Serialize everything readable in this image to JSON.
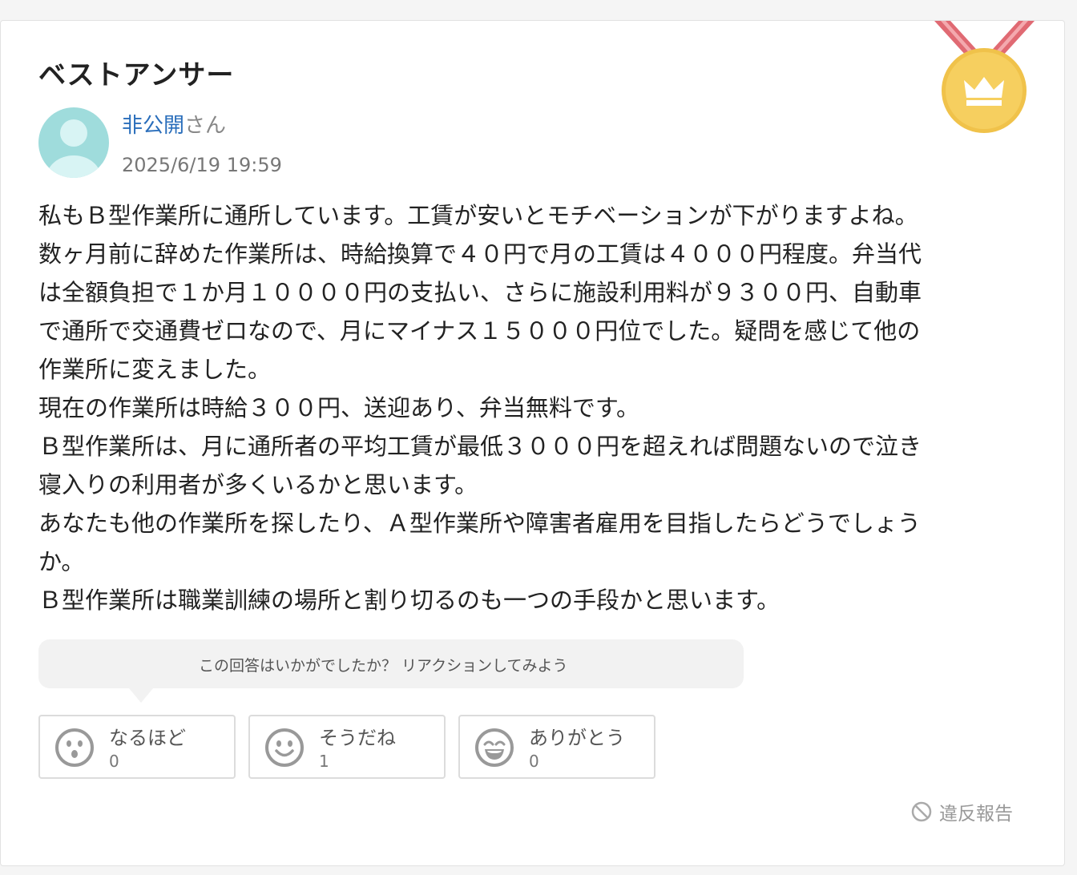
{
  "answer": {
    "heading": "ベストアンサー",
    "author_name": "非公開",
    "author_suffix": "さん",
    "date": "2025/6/19 19:59",
    "body_lines": [
      "私もＢ型作業所に通所しています。工賃が安いとモチベーションが下がりますよね。",
      "数ヶ月前に辞めた作業所は、時給換算で４０円で月の工賃は４０００円程度。弁当代",
      "は全額負担で１か月１００００円の支払い、さらに施設利用料が９３００円、自動車",
      "で通所で交通費ゼロなので、月にマイナス１５０００円位でした。疑問を感じて他の",
      "作業所に変えました。",
      "現在の作業所は時給３００円、送迎あり、弁当無料です。",
      "Ｂ型作業所は、月に通所者の平均工賃が最低３０００円を超えれば問題ないので泣き",
      "寝入りの利用者が多くいるかと思います。",
      "あなたも他の作業所を探したり、Ａ型作業所や障害者雇用を目指したらどうでしょう",
      "か。",
      "Ｂ型作業所は職業訓練の場所と割り切るのも一つの手段かと思います。"
    ]
  },
  "reaction_prompt": "この回答はいかがでしたか？ リアクションしてみよう",
  "reactions": [
    {
      "label": "なるほど",
      "count": "0",
      "icon": "surprised-face-icon"
    },
    {
      "label": "そうだね",
      "count": "1",
      "icon": "smile-face-icon"
    },
    {
      "label": "ありがとう",
      "count": "0",
      "icon": "grin-face-icon"
    }
  ],
  "report_label": "違反報告",
  "colors": {
    "author_link": "#2a6ebb",
    "medal_gold": "#f3c64e",
    "ribbon": "#e06a73",
    "avatar": "#9fdcdc"
  }
}
